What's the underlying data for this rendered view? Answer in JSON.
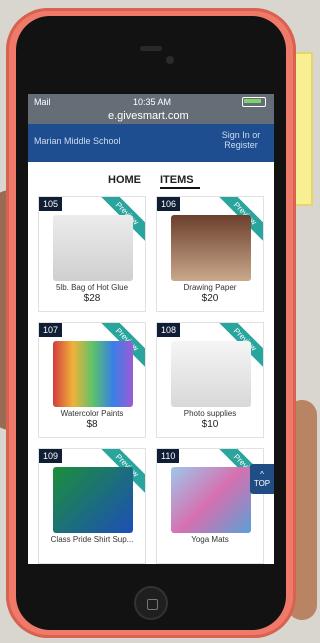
{
  "status": {
    "carrier": "Mail",
    "time": "10:35 AM",
    "url": "e.givesmart.com"
  },
  "header": {
    "school": "Marian Middle School",
    "auth": "Sign In or Register"
  },
  "tabs": {
    "home": "HOME",
    "items": "ITEMS"
  },
  "items": [
    {
      "id": "105",
      "title": "5lb. Bag of Hot Glue",
      "price": "$28",
      "ribbon": "Preview"
    },
    {
      "id": "106",
      "title": "Drawing Paper",
      "price": "$20",
      "ribbon": "Preview"
    },
    {
      "id": "107",
      "title": "Watercolor Paints",
      "price": "$8",
      "ribbon": "Preview"
    },
    {
      "id": "108",
      "title": "Photo supplies",
      "price": "$10",
      "ribbon": "Preview"
    },
    {
      "id": "109",
      "title": "Class Pride Shirt Sup...",
      "price": "",
      "ribbon": "Preview"
    },
    {
      "id": "110",
      "title": "Yoga Mats",
      "price": "",
      "ribbon": "Preview"
    }
  ],
  "top": {
    "label": "TOP"
  }
}
